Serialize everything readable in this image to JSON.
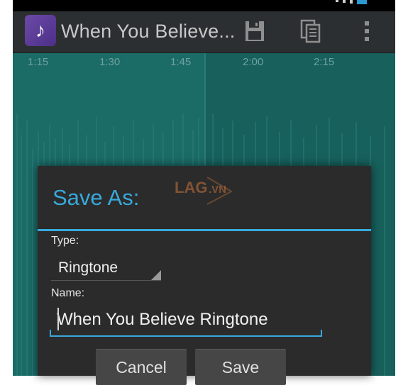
{
  "actionbar": {
    "title": "When You Believe...",
    "icon_app": "music-note-icon",
    "icon_save": "save-icon",
    "icon_copy": "copy-icon",
    "icon_more": "overflow-menu-icon"
  },
  "timeline": {
    "ticks": [
      "1:15",
      "1:30",
      "1:45",
      "2:00",
      "2:15"
    ]
  },
  "watermark": {
    "text": "LAG.VN"
  },
  "dialog": {
    "title": "Save As:",
    "type_label": "Type:",
    "type_value": "Ringtone",
    "name_label": "Name:",
    "name_value": "When You Believe Ringtone",
    "cancel_label": "Cancel",
    "save_label": "Save"
  },
  "colors": {
    "accent": "#38a9dc",
    "waveform_bg": "#1b6b67",
    "dialog_bg": "#2b2b2b",
    "actionbar_bg": "#2c2f31"
  }
}
